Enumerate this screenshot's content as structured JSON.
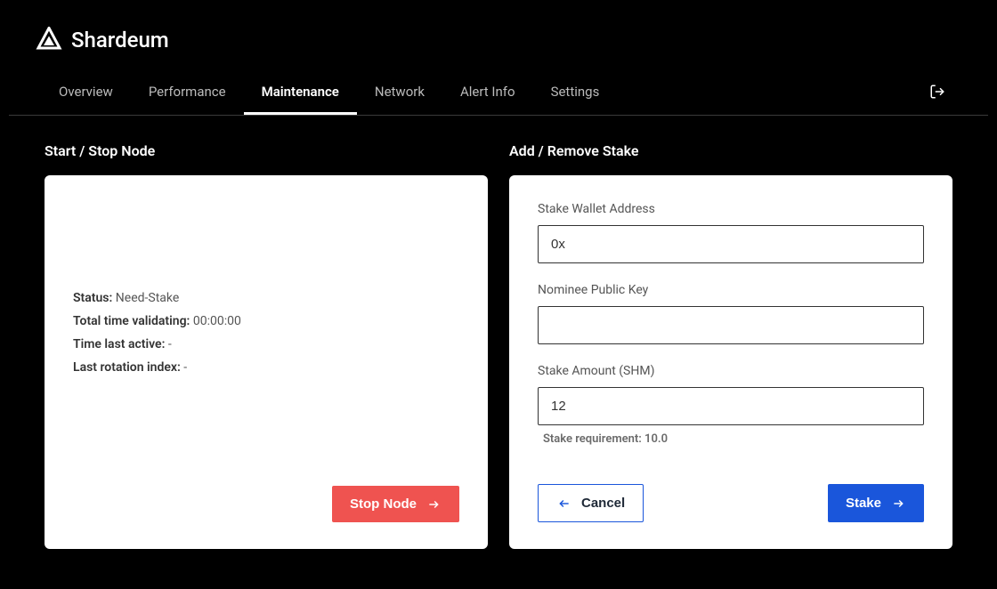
{
  "brand": "Shardeum",
  "tabs": {
    "overview": "Overview",
    "performance": "Performance",
    "maintenance": "Maintenance",
    "network": "Network",
    "alert_info": "Alert Info",
    "settings": "Settings"
  },
  "left": {
    "section_title": "Start / Stop Node",
    "status_label": "Status:",
    "status_value": "Need-Stake",
    "total_time_label": "Total time validating:",
    "total_time_value": "00:00:00",
    "time_last_active_label": "Time last active:",
    "time_last_active_value": "-",
    "last_rotation_label": "Last rotation index:",
    "last_rotation_value": "-",
    "stop_button": "Stop Node"
  },
  "right": {
    "section_title": "Add / Remove Stake",
    "wallet_label": "Stake Wallet Address",
    "wallet_value": "0x",
    "nominee_label": "Nominee Public Key",
    "nominee_value": "",
    "amount_label": "Stake Amount (SHM)",
    "amount_value": "12",
    "requirement_text": "Stake requirement: 10.0",
    "cancel_button": "Cancel",
    "stake_button": "Stake"
  }
}
